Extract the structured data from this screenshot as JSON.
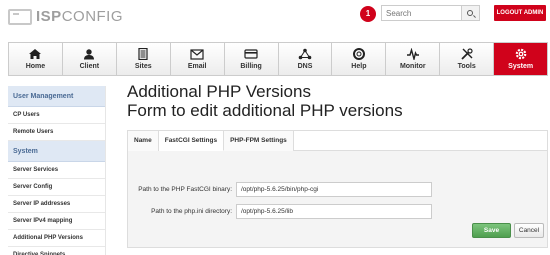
{
  "header": {
    "logo_bold": "ISP",
    "logo_thin": "CONFIG",
    "notification_count": "1",
    "search": {
      "placeholder": "Search",
      "value": ""
    },
    "logout_label": "LOGOUT ADMIN"
  },
  "nav": {
    "items": [
      {
        "label": "Home",
        "icon": "home-icon"
      },
      {
        "label": "Client",
        "icon": "user-icon"
      },
      {
        "label": "Sites",
        "icon": "sites-icon"
      },
      {
        "label": "Email",
        "icon": "email-icon"
      },
      {
        "label": "Billing",
        "icon": "billing-icon"
      },
      {
        "label": "DNS",
        "icon": "dns-icon"
      },
      {
        "label": "Help",
        "icon": "help-icon"
      },
      {
        "label": "Monitor",
        "icon": "monitor-icon"
      },
      {
        "label": "Tools",
        "icon": "tools-icon"
      },
      {
        "label": "System",
        "icon": "gear-icon",
        "active": true
      }
    ]
  },
  "sidebar": {
    "sections": [
      {
        "heading": "User Management",
        "items": [
          "CP Users",
          "Remote Users"
        ]
      },
      {
        "heading": "System",
        "items": [
          "Server Services",
          "Server Config",
          "Server IP addresses",
          "Server IPv4 mapping",
          "Additional PHP Versions",
          "Directive Snippets"
        ]
      }
    ]
  },
  "main": {
    "title_line1": "Additional PHP Versions",
    "title_line2": "Form to edit additional PHP versions",
    "tabs": [
      {
        "label": "Name"
      },
      {
        "label": "FastCGI Settings",
        "active": true
      },
      {
        "label": "PHP-FPM Settings"
      }
    ],
    "fields": [
      {
        "label": "Path to the PHP FastCGI binary:",
        "value": "/opt/php-5.6.25/bin/php-cgi"
      },
      {
        "label": "Path to the php.ini directory:",
        "value": "/opt/php-5.6.25/lib"
      }
    ],
    "save_label": "Save",
    "cancel_label": "Cancel"
  },
  "colors": {
    "accent": "#d0021b",
    "sidebar_heading_bg": "#dfe8f4",
    "save_green": "#5aab5a"
  }
}
